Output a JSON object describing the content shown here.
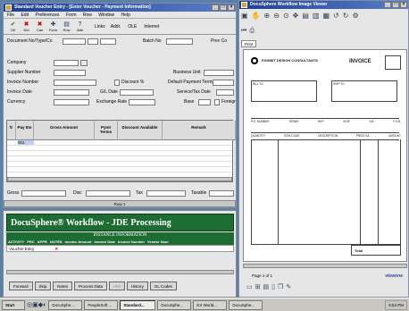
{
  "voucher": {
    "title": "Standard Voucher Entry - [Enter Voucher - Payment Information]",
    "menu": [
      "File",
      "Edit",
      "Preferences",
      "Form",
      "Row",
      "Window",
      "Help"
    ],
    "tools": [
      {
        "icon": "✔",
        "label": "OK"
      },
      {
        "icon": "✖",
        "label": "Del"
      },
      {
        "icon": "✖",
        "label": "Can"
      },
      {
        "icon": "✚",
        "label": "Form"
      },
      {
        "icon": "▤",
        "label": "Row"
      },
      {
        "icon": "?",
        "label": "Attn"
      }
    ],
    "links_label": "Links",
    "addr_label": "Addr.",
    "ole_label": "OLE",
    "internet_label": "Internet",
    "fields": {
      "doc": "Document No/Type/Co",
      "batch": "Batch No",
      "prevco": "Prev Co",
      "company": "Company",
      "supplier": "Supplier Number",
      "bunit": "Business Unit",
      "invnum": "Invoice Number",
      "discount": "Discount %",
      "defpay": "Default Payment Terms",
      "invdate": "Invoice Date",
      "gldate": "G/L Date",
      "svcdate": "Service/Tax Date",
      "currency": "Currency",
      "xrate": "Exchange Rate",
      "base": "Base",
      "foreign": "Foreign"
    },
    "grid_headers": [
      "Pay Itm",
      "Gross Amount",
      "Pymt Terms",
      "Discount Available",
      "Remark"
    ],
    "grid_first_row": "001",
    "totals": {
      "gross": "Gross",
      "disc": "Disc",
      "tax": "Tax",
      "taxable": "Taxable"
    },
    "row_indicator": "Row 1"
  },
  "workflow": {
    "title": "DocuSphere® Workflow - JDE Processing",
    "subtitle": "INSTANCE INFORMATION",
    "columns": [
      "ACTIVITY",
      "PRC",
      "APPR",
      "NOTES",
      "Invoice Amount",
      "Invoice Date",
      "Invoice Number",
      "Vendor Num"
    ],
    "row_activity": "Voucher Entry",
    "row_mark": "✕",
    "buttons": [
      "Forward",
      "Skip",
      "Notes",
      "Process Data",
      "Hist",
      "History",
      "GL Codes"
    ]
  },
  "viewer": {
    "title": "DocuSphere Workflow Image Viewer",
    "tab": "Print",
    "company": "EXHIBIT DESIGN CONSULTANTS",
    "doc_type": "INVOICE",
    "bill_to": "BILL TO",
    "ship_to": "SHIP TO",
    "table_headers": [
      "P.O. NUMBER",
      "TERMS",
      "REP",
      "SHIP",
      "VIA",
      "F.O.B."
    ],
    "item_headers": [
      "QUANTITY",
      "ITEM CODE",
      "DESCRIPTION",
      "PRICE EA.",
      "AMOUNT"
    ],
    "total_label": "Total",
    "page_label": "Page 1 of 1",
    "brand": "viewone"
  },
  "taskbar": {
    "start": "Start",
    "items": [
      "DocuSphe...",
      "PeopleSoft ...",
      "Standard...",
      "DocuSphe...",
      "EX World...",
      "DocuSphe..."
    ],
    "clock": "5:54 PM"
  }
}
